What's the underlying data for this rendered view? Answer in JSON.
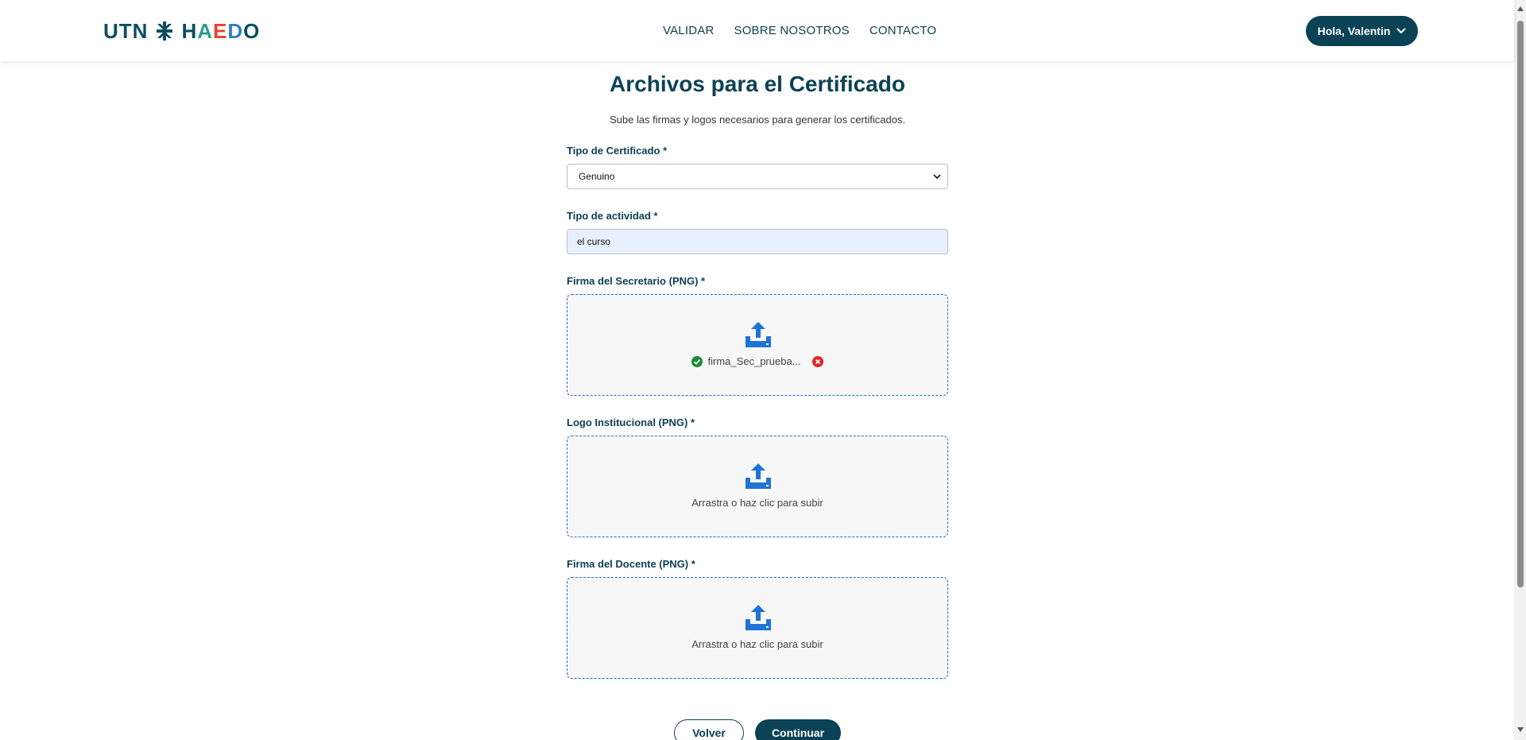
{
  "header": {
    "logo_text_left": "UTN",
    "logo_text_right": [
      "H",
      "A",
      "E",
      "D",
      "O"
    ],
    "nav": [
      "VALIDAR",
      "SOBRE NOSOTROS",
      "CONTACTO"
    ],
    "user_greeting": "Hola, Valentin"
  },
  "page": {
    "title": "Archivos para el Certificado",
    "subtitle": "Sube las firmas y logos necesarios para generar los certificados."
  },
  "form": {
    "cert_type": {
      "label": "Tipo de Certificado *",
      "value": "Genuino"
    },
    "activity_type": {
      "label": "Tipo de actividad *",
      "value": "el curso"
    },
    "secretary_signature": {
      "label": "Firma del Secretario (PNG) *",
      "file_name": "firma_Sec_prueba...",
      "status": "uploaded"
    },
    "institutional_logo": {
      "label": "Logo Institucional (PNG) *",
      "hint": "Arrastra o haz clic para subir"
    },
    "teacher_signature": {
      "label": "Firma del Docente (PNG) *",
      "hint": "Arrastra o haz clic para subir"
    }
  },
  "actions": {
    "back": "Volver",
    "continue": "Continuar"
  },
  "colors": {
    "primary": "#0b4255",
    "accent_blue": "#1e74d4",
    "success": "#1e8a3a",
    "error": "#e02424",
    "logo_letters": [
      "#0b4d62",
      "#7ac143",
      "#2f80c3",
      "#e8402f",
      "#0b4d62"
    ]
  },
  "icons": [
    "utn-star-icon",
    "chevron-down-icon",
    "upload-icon",
    "check-circle-icon",
    "close-circle-icon"
  ]
}
